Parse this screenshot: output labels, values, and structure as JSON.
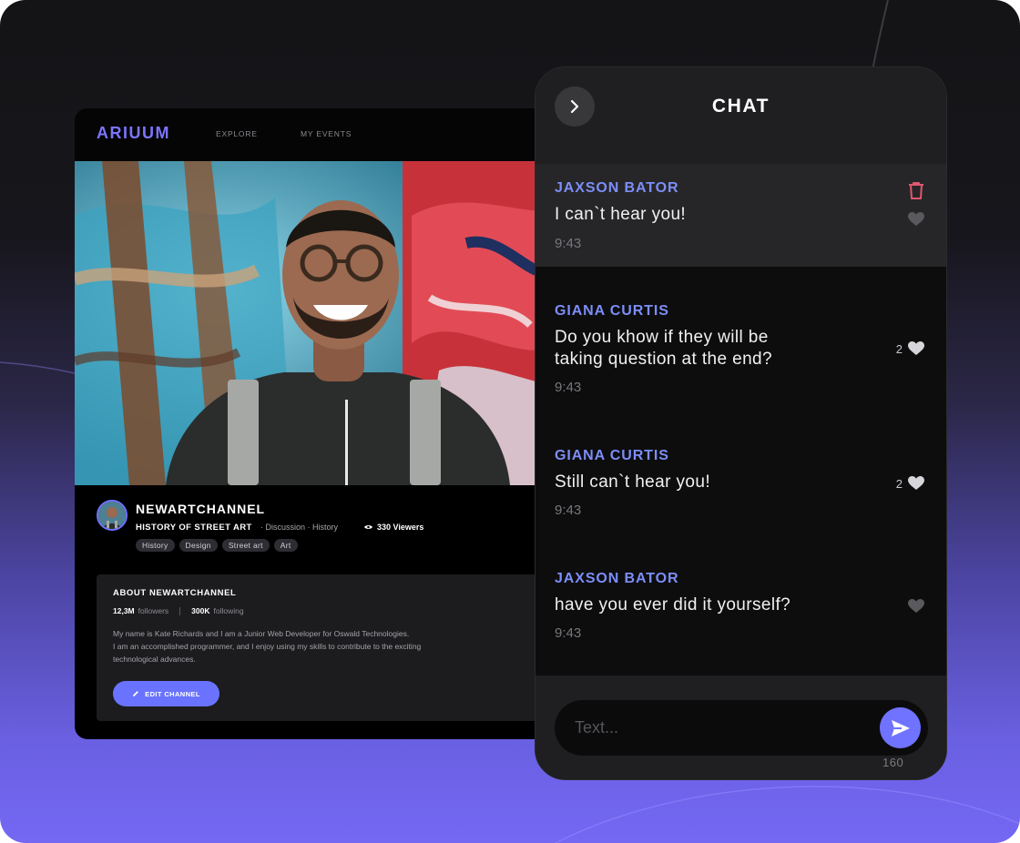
{
  "app": {
    "logo": "ARIUUM",
    "nav": [
      "EXPLORE",
      "MY EVENTS"
    ]
  },
  "channel": {
    "name": "NEWARTCHANNEL",
    "stream_title": "HISTORY OF STREET ART",
    "categories": "· Discussion · History",
    "viewers": "330 Viewers",
    "tags": [
      "History",
      "Design",
      "Street art",
      "Art"
    ]
  },
  "about": {
    "title": "ABOUT NEWARTCHANNEL",
    "followers_count": "12,3M",
    "followers_label": "followers",
    "following_count": "300K",
    "following_label": "following",
    "bio": [
      "My name is Kate Richards and I am a Junior Web Developer for Oswald Technologies.",
      "I am an accomplished programmer, and I enjoy using my skills to contribute to the exciting",
      "technological advances."
    ],
    "edit_button": "EDIT CHANNEL"
  },
  "chat": {
    "title": "CHAT",
    "messages": [
      {
        "user": "JAXSON BATOR",
        "lines": [
          "I can`t hear you!"
        ],
        "time": "9:43",
        "likes": ""
      },
      {
        "user": "GIANA CURTIS",
        "lines": [
          "Do you khow if they will be",
          "taking question at the end?"
        ],
        "time": "9:43",
        "likes": "2"
      },
      {
        "user": "GIANA CURTIS",
        "lines": [
          "Still can`t hear you!"
        ],
        "time": "9:43",
        "likes": "2"
      },
      {
        "user": "JAXSON BATOR",
        "lines": [
          "have you ever did it yourself?"
        ],
        "time": "9:43",
        "likes": ""
      }
    ],
    "input_placeholder": "Text...",
    "char_limit": "160"
  },
  "colors": {
    "accent": "#6f73ff",
    "username": "#7c8ef7",
    "delete": "#e2566f"
  },
  "icons": [
    "chevron-right-icon",
    "trash-icon",
    "heart-icon",
    "send-icon",
    "eye-icon",
    "pencil-icon"
  ]
}
